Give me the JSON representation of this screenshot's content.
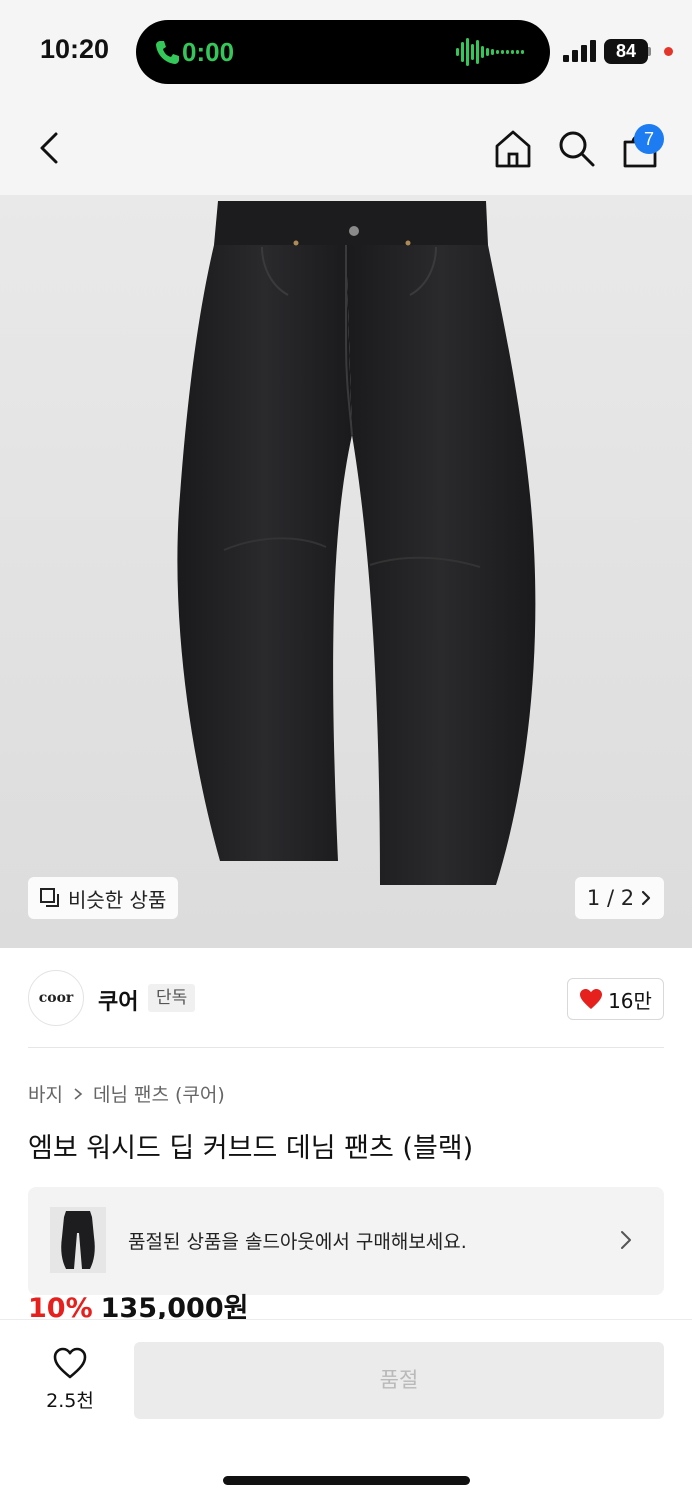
{
  "status_bar": {
    "time": "10:20",
    "call_timer": "0:00",
    "battery": "84",
    "signal_icon": "cellular-signal-icon",
    "call_icon": "phone-call-icon"
  },
  "nav": {
    "back_icon": "chevron-left-icon",
    "home_icon": "home-icon",
    "search_icon": "search-icon",
    "cart_icon": "shopping-bag-icon",
    "cart_badge": "7"
  },
  "gallery": {
    "similar_label": "비슷한 상품",
    "pager_text": "1 / 2"
  },
  "brand": {
    "logo_text": "coor",
    "name": "쿠어",
    "badge": "단독",
    "likes": "16만"
  },
  "breadcrumb": {
    "category": "바지",
    "subcategory": "데님 팬츠 (쿠어)"
  },
  "product": {
    "title": "엠보 워시드 딥 커브드 데님 팬츠 (블랙)",
    "discount": "10%",
    "price": "135,000원"
  },
  "soldout_banner": {
    "text": "품절된 상품을 솔드아웃에서 구매해보세요."
  },
  "bottom_bar": {
    "wish_count": "2.5천",
    "cta_label": "품절"
  },
  "colors": {
    "accent_blue": "#1d7cf2",
    "discount_red": "#e6201d",
    "call_green": "#34c759"
  }
}
